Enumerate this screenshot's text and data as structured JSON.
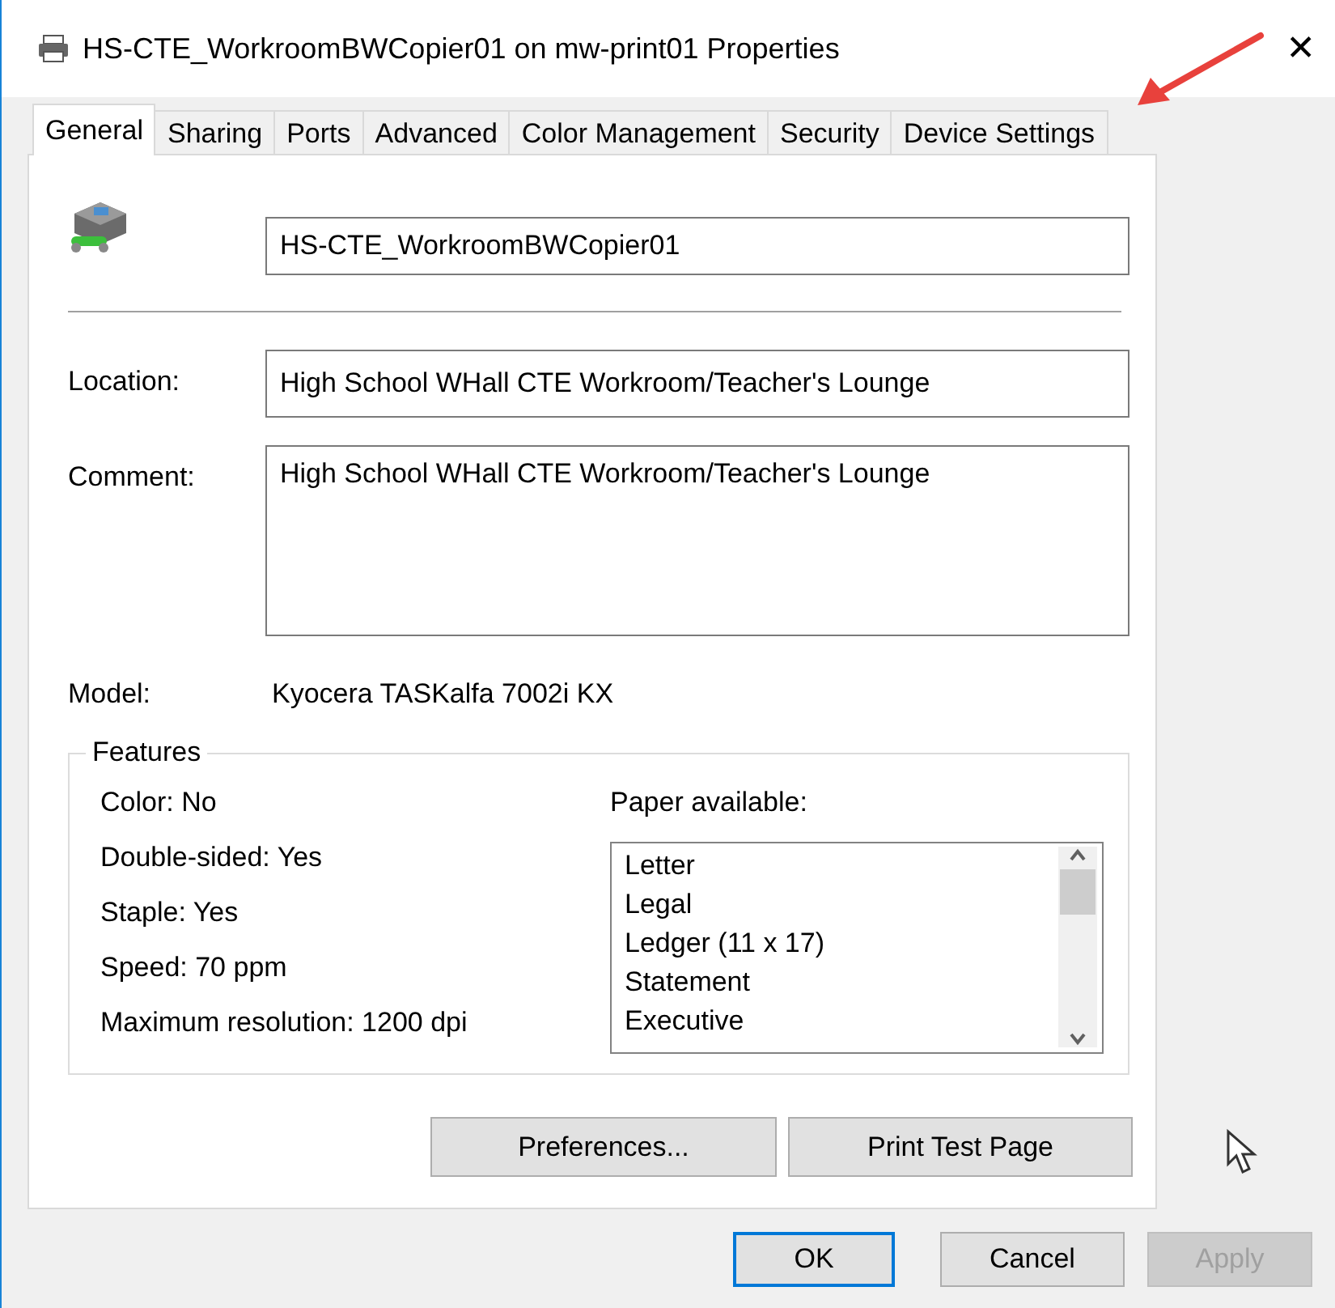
{
  "window": {
    "title": "HS-CTE_WorkroomBWCopier01 on mw-print01 Properties",
    "close": "✕"
  },
  "tabs": [
    {
      "label": "General",
      "selected": true
    },
    {
      "label": "Sharing",
      "selected": false
    },
    {
      "label": "Ports",
      "selected": false
    },
    {
      "label": "Advanced",
      "selected": false
    },
    {
      "label": "Color Management",
      "selected": false
    },
    {
      "label": "Security",
      "selected": false
    },
    {
      "label": "Device Settings",
      "selected": false
    }
  ],
  "general": {
    "printer_name": "HS-CTE_WorkroomBWCopier01",
    "location": {
      "label": "Location:",
      "value": "High School WHall CTE Workroom/Teacher's Lounge"
    },
    "comment": {
      "label": "Comment:",
      "value": "High School WHall CTE Workroom/Teacher's Lounge"
    },
    "model": {
      "label": "Model:",
      "value": "Kyocera TASKalfa 7002i KX"
    },
    "features": {
      "title": "Features",
      "items": [
        "Color: No",
        "Double-sided: Yes",
        "Staple: Yes",
        "Speed: 70 ppm",
        "Maximum resolution: 1200 dpi"
      ],
      "paper_label": "Paper available:",
      "paper": [
        "Letter",
        "Legal",
        "Ledger (11 x 17)",
        "Statement",
        "Executive"
      ]
    },
    "buttons": [
      "Preferences...",
      "Print Test Page"
    ]
  },
  "dialog_buttons": [
    {
      "label": "OK",
      "default": true,
      "disabled": false
    },
    {
      "label": "Cancel",
      "default": false,
      "disabled": false
    },
    {
      "label": "Apply",
      "default": false,
      "disabled": true
    }
  ]
}
